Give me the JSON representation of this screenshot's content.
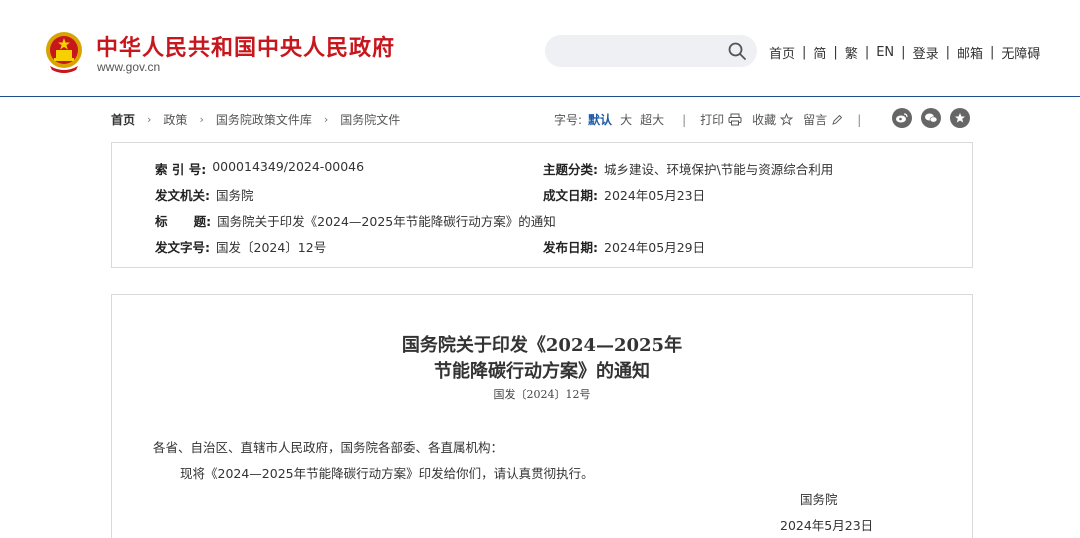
{
  "header": {
    "site_title": "中华人民共和国中央人民政府",
    "site_domain": "www.gov.cn",
    "search": {
      "placeholder": "",
      "value": ""
    },
    "nav": [
      {
        "label": "首页"
      },
      {
        "label": "简"
      },
      {
        "label": "繁"
      },
      {
        "label": "EN"
      },
      {
        "label": "登录"
      },
      {
        "label": "邮箱"
      },
      {
        "label": "无障碍"
      }
    ],
    "nav_separator": "|"
  },
  "breadcrumb": [
    {
      "label": "首页"
    },
    {
      "label": "政策"
    },
    {
      "label": "国务院政策文件库"
    },
    {
      "label": "国务院文件"
    }
  ],
  "breadcrumb_separator": "›",
  "toolbar": {
    "font_size_label": "字号:",
    "sizes": [
      {
        "label": "默认",
        "active": true
      },
      {
        "label": "大",
        "active": false
      },
      {
        "label": "超大",
        "active": false
      }
    ],
    "separator": "|",
    "print_label": "打印",
    "favorite_label": "收藏",
    "comment_label": "留言",
    "share_icons": [
      "weibo-icon",
      "wechat-icon",
      "qzone-icon"
    ]
  },
  "meta": {
    "index_key": "索 引 号:",
    "index_value": "000014349/2024-00046",
    "topic_key": "主题分类:",
    "topic_value": "城乡建设、环境保护\\节能与资源综合利用",
    "issuer_key": "发文机关:",
    "issuer_value": "国务院",
    "written_key": "成文日期:",
    "written_value": "2024年05月23日",
    "title_key": "标      题:",
    "title_value": "国务院关于印发《2024—2025年节能降碳行动方案》的通知",
    "docno_key": "发文字号:",
    "docno_value": "国发〔2024〕12号",
    "published_key": "发布日期:",
    "published_value": "2024年05月29日"
  },
  "document": {
    "title_line1": "国务院关于印发《2024—2025年",
    "title_line2": "节能降碳行动方案》的通知",
    "doc_number": "国发〔2024〕12号",
    "salutation": "各省、自治区、直辖市人民政府，国务院各部委、各直属机构：",
    "body": "现将《2024—2025年节能降碳行动方案》印发给你们，请认真贯彻执行。",
    "signature": "国务院",
    "date": "2024年5月23日"
  },
  "colors": {
    "brand_red": "#c8161d",
    "link_blue": "#1f5aa6",
    "header_border": "#1f4e8c"
  }
}
